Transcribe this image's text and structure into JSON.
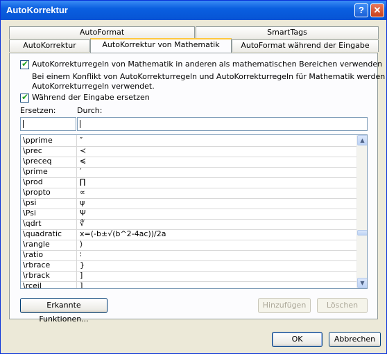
{
  "window": {
    "title": "AutoKorrektur",
    "help_label": "?",
    "close_label": "✕"
  },
  "tabs_top": [
    {
      "label": "AutoFormat"
    },
    {
      "label": "SmartTags"
    }
  ],
  "tabs_bottom": [
    {
      "label": "AutoKorrektur"
    },
    {
      "label": "AutoKorrektur von Mathematik",
      "active": true
    },
    {
      "label": "AutoFormat während der Eingabe"
    }
  ],
  "options": {
    "use_outside_math": {
      "checked": true,
      "label": "AutoKorrekturregeln von Mathematik in anderen als mathematischen Bereichen verwenden"
    },
    "conflict_note": [
      "Bei einem Konflikt von AutoKorrekturregeln und AutoKorrekturregeln für Mathematik werden",
      "AutoKorrekturregeln verwendet."
    ],
    "replace_while_typing": {
      "checked": true,
      "label": "Während der Eingabe ersetzen"
    }
  },
  "fields": {
    "replace_label": "Ersetzen:",
    "with_label": "Durch:",
    "replace_value": "",
    "with_value": ""
  },
  "entries": [
    {
      "key": "\\pprime",
      "value": "″"
    },
    {
      "key": "\\prec",
      "value": "≺"
    },
    {
      "key": "\\preceq",
      "value": "≼"
    },
    {
      "key": "\\prime",
      "value": "′"
    },
    {
      "key": "\\prod",
      "value": "∏"
    },
    {
      "key": "\\propto",
      "value": "∝"
    },
    {
      "key": "\\psi",
      "value": "ψ"
    },
    {
      "key": "\\Psi",
      "value": "Ψ"
    },
    {
      "key": "\\qdrt",
      "value": "∜"
    },
    {
      "key": "\\quadratic",
      "value": "x=(-b±√(b^2-4ac))/2a"
    },
    {
      "key": "\\rangle",
      "value": "⟩"
    },
    {
      "key": "\\ratio",
      "value": "∶"
    },
    {
      "key": "\\rbrace",
      "value": "}"
    },
    {
      "key": "\\rbrack",
      "value": "]"
    },
    {
      "key": "\\rceil",
      "value": "⌉"
    }
  ],
  "buttons": {
    "recognized_functions": "Erkannte Funktionen...",
    "add": "Hinzufügen",
    "delete": "Löschen",
    "ok": "OK",
    "cancel": "Abbrechen"
  },
  "icons": {
    "check": "✔",
    "scroll_up": "▲",
    "scroll_down": "▼"
  }
}
